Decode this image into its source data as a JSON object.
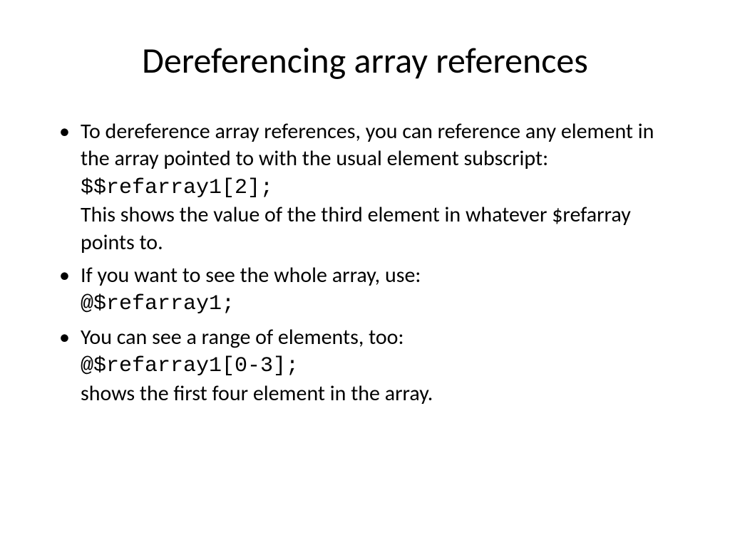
{
  "slide": {
    "title": "Dereferencing array references",
    "bullets": [
      {
        "text_before": "To dereference array references, you can reference any element in the array pointed to with the usual element subscript:",
        "code": "$$refarray1[2];",
        "text_after": "This shows the value of the third element in whatever $refarray points to."
      },
      {
        "text_before": "If you want to see the whole array, use:",
        "code": "@$refarray1;",
        "text_after": ""
      },
      {
        "text_before": "You can see a range of elements, too:",
        "code": "@$refarray1[0-3];",
        "text_after": "shows the first four element in the array."
      }
    ]
  }
}
